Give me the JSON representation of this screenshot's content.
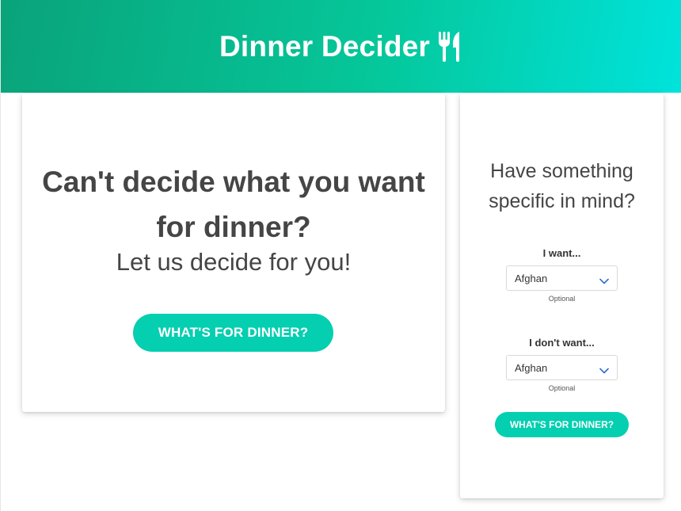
{
  "header": {
    "title": "Dinner Decider",
    "icon": "utensils-icon",
    "gradient_start": "#0aa37a",
    "gradient_end": "#00e3dc"
  },
  "main": {
    "heading": "Can't decide what you want for dinner?",
    "subheading": "Let us decide for you!",
    "button_label": "WHAT'S FOR DINNER?"
  },
  "side": {
    "heading": "Have something specific in mind?",
    "want": {
      "label": "I want...",
      "selected": "Afghan",
      "hint": "Optional"
    },
    "dont_want": {
      "label": "I don't want...",
      "selected": "Afghan",
      "hint": "Optional"
    },
    "button_label": "WHAT'S FOR DINNER?"
  },
  "colors": {
    "accent": "#04cfb0",
    "text": "#454545"
  }
}
